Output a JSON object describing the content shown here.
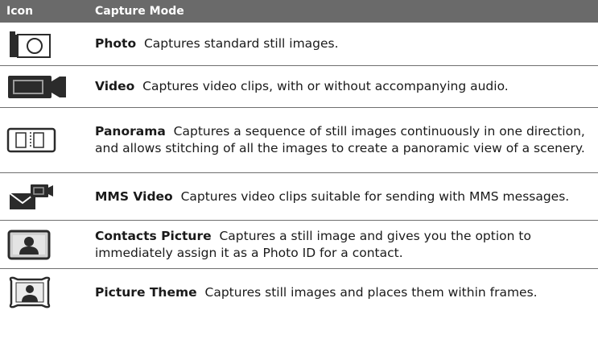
{
  "header": {
    "col_icon": "Icon",
    "col_mode": "Capture Mode"
  },
  "rows": [
    {
      "icon": "photo-camera-icon",
      "title": "Photo",
      "text": "Captures standard still images."
    },
    {
      "icon": "video-camera-icon",
      "title": "Video",
      "text": "Captures video clips, with or without accompanying audio."
    },
    {
      "icon": "panorama-icon",
      "title": "Panorama",
      "text": "Captures a sequence of still images continuously in one direction, and allows stitching of all the images to create a panoramic view of a scenery."
    },
    {
      "icon": "mms-video-icon",
      "title": "MMS Video",
      "text": "Captures video clips suitable for sending with MMS messages."
    },
    {
      "icon": "contacts-picture-icon",
      "title": "Contacts Picture",
      "text": "Captures a still image and gives you the option to immediately assign it as a Photo ID for a contact."
    },
    {
      "icon": "picture-theme-icon",
      "title": "Picture Theme",
      "text": "Captures still images and places them within frames."
    }
  ],
  "colors": {
    "header_bg": "#6a6a6a",
    "icon_dark": "#2b2b2b",
    "divider": "#6f6f6f"
  }
}
